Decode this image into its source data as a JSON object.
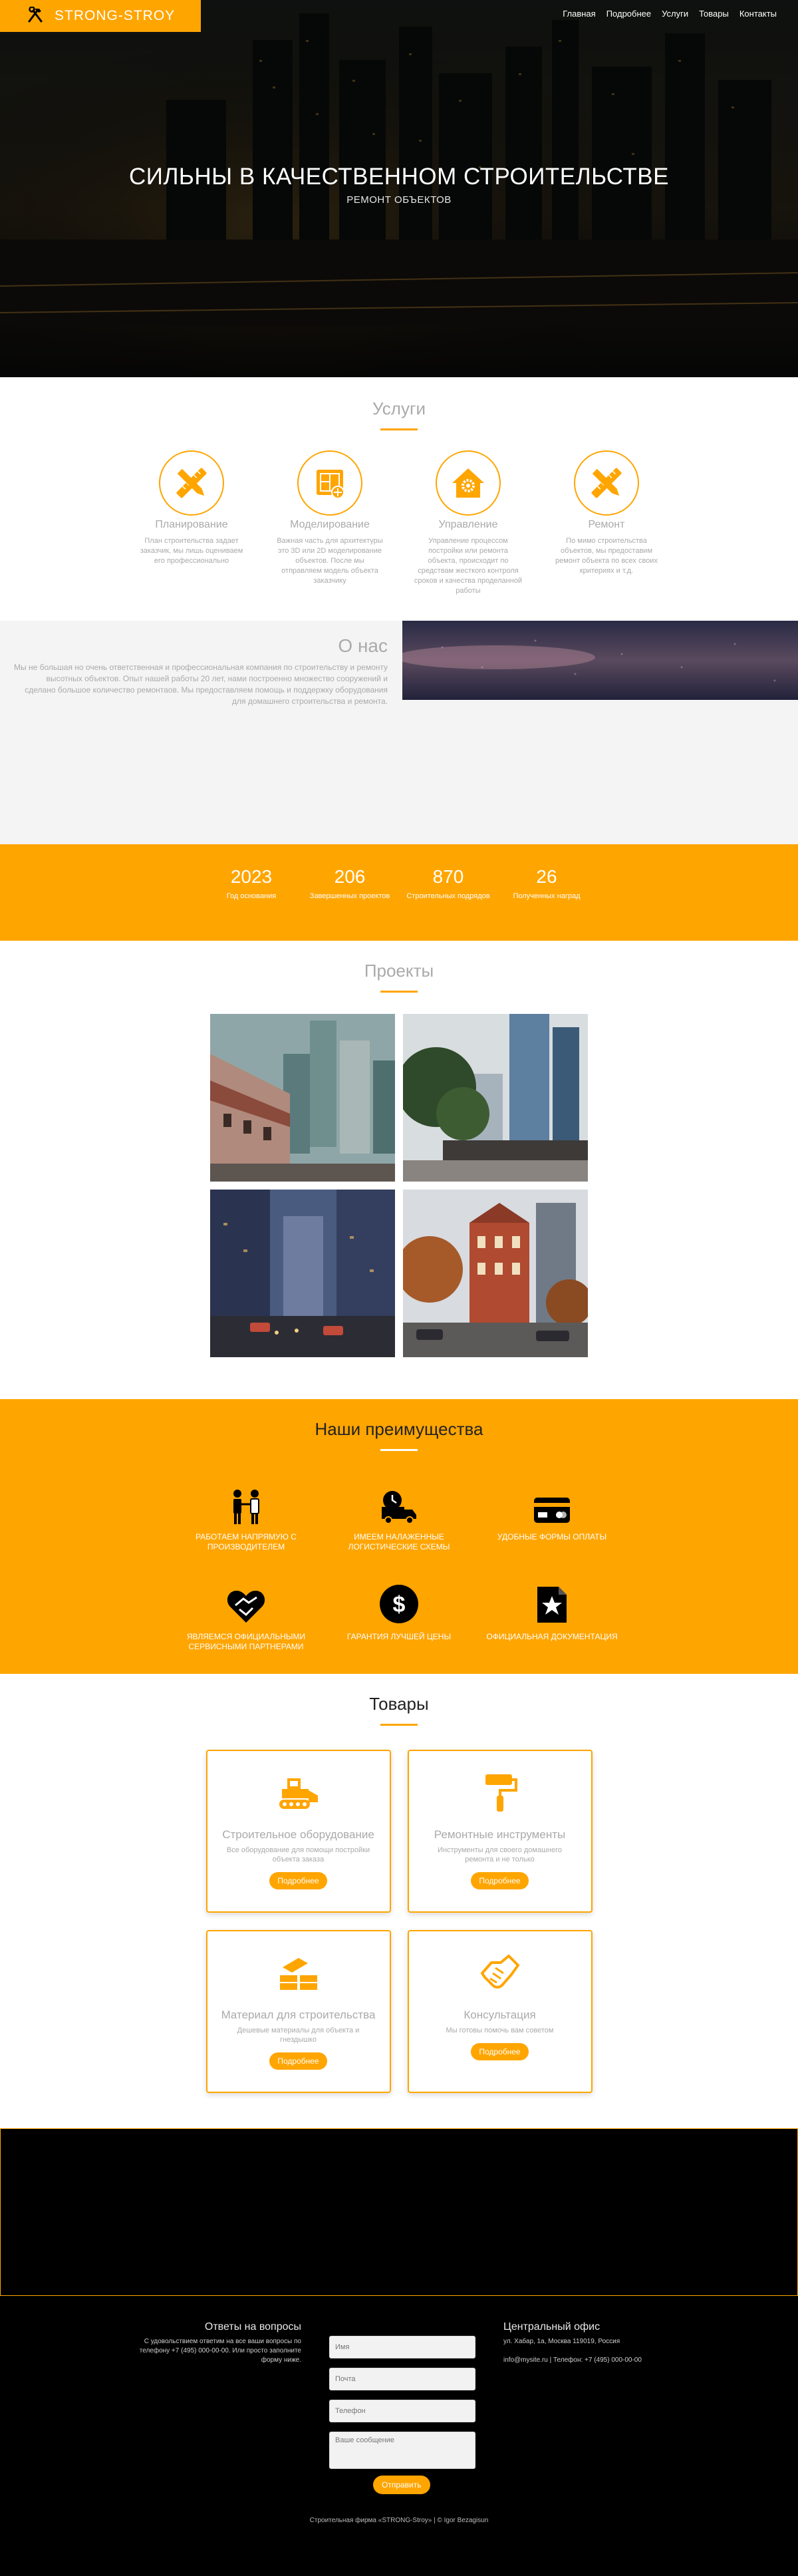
{
  "nav": {
    "brand": "STRONG-STROY",
    "links": [
      "Главная",
      "Подробнее",
      "Услуги",
      "Товары",
      "Контакты"
    ]
  },
  "hero": {
    "title": "СИЛЬНЫ В КАЧЕСТВЕННОМ СТРОИТЕЛЬСТВЕ",
    "subtitle": "РЕМОНТ ОБЪЕКТОВ"
  },
  "services": {
    "title": "Услуги",
    "items": [
      {
        "name": "Планирование",
        "desc": "План строительства задает заказчик, мы лишь оцениваем его профессионально",
        "icon": "pencil-ruler-icon"
      },
      {
        "name": "Моделирование",
        "desc": "Важная часть для архитектуры это 3D или 2D моделирование объектов. После мы отправляем модель объекта заказчику",
        "icon": "blueprint-icon"
      },
      {
        "name": "Управление",
        "desc": "Управление процессом постройки или ремонта объекта, происходит по средствам жесткого контроля сроков и качества проделанной работы",
        "icon": "house-gear-icon"
      },
      {
        "name": "Ремонт",
        "desc": "По мимо строительства объектов, мы предоставим ремонт объекта по всех своих критериях и т.д.",
        "icon": "pencil-ruler-icon"
      }
    ]
  },
  "about": {
    "title": "О нас",
    "text": "Мы не большая но очень ответственная и профессиональная компания по строительству и ремонту высотных объектов. Опыт нашей работы 20 лет, нами построенно множество сооружений и сделано большое количество ремонтаов. Мы предоставляем помощь и поддержку оборудования для домашнего строительства и ремонта."
  },
  "stats": [
    {
      "num": "2023",
      "label": "Год основания"
    },
    {
      "num": "206",
      "label": "Завершенных проектов"
    },
    {
      "num": "870",
      "label": "Строительных подрядов"
    },
    {
      "num": "26",
      "label": "Полученных наград"
    }
  ],
  "projects": {
    "title": "Проекты"
  },
  "advantages": {
    "title": "Наши преимущества",
    "items": [
      {
        "label": "РАБОТАЕМ НАПРЯМУЮ С ПРОИЗВОДИТЕЛЕМ",
        "icon": "handshake-people-icon"
      },
      {
        "label": "ИМЕЕМ НАЛАЖЕННЫЕ ЛОГИСТИЧЕСКИЕ СХЕМЫ",
        "icon": "delivery-truck-icon"
      },
      {
        "label": "УДОБНЫЕ ФОРМЫ ОПЛАТЫ",
        "icon": "credit-card-icon"
      },
      {
        "label": "ЯВЛЯЕМСЯ ОФИЦИАЛЬНЫМИ СЕРВИСНЫМИ ПАРТНЕРАМИ",
        "icon": "heart-handshake-icon"
      },
      {
        "label": "ГАРАНТИЯ ЛУЧШЕЙ ЦЕНЫ",
        "icon": "dollar-icon"
      },
      {
        "label": "ОФИЦИАЛЬНАЯ ДОКУМЕНТАЦИЯ",
        "icon": "document-star-icon"
      }
    ]
  },
  "goods": {
    "title": "Товары",
    "items": [
      {
        "title": "Строительное оборудование",
        "desc": "Все оборудование для помощи постройки объекта заказа",
        "button": "Подробнее",
        "icon": "bulldozer-icon"
      },
      {
        "title": "Ремонтные инструменты",
        "desc": "Инструменты для своего домашнего ремонта и не только",
        "button": "Подробнее",
        "icon": "paint-roller-icon"
      },
      {
        "title": "Материал для строительства",
        "desc": "Дешевые материалы для объекта и гнездышко",
        "button": "Подробнее",
        "icon": "bricks-icon"
      },
      {
        "title": "Консультация",
        "desc": "Мы готовы помочь вам советом",
        "button": "Подробнее",
        "icon": "handshake-icon"
      }
    ]
  },
  "footer": {
    "contact_title": "Ответы на вопросы",
    "contact_text": "С удовольствием ответим на все ваши вопросы по телефону +7 (495) 000-00-00. Или просто заполните форму ниже.",
    "form": {
      "name_placeholder": "Имя",
      "email_placeholder": "Почта",
      "phone_placeholder": "Телефон",
      "message_placeholder": "Ваше сообщение",
      "send_label": "Отправить"
    },
    "office_title": "Центральный офис",
    "address": "ул. Хабар, 1а, Москва 119019, Россия",
    "email_phone": "info@mysite.ru  |  Телефон: +7 (495) 000-00-00",
    "copyright": "Строительная фирма «STRONG-Stroy» | © Igor Bezagisun"
  },
  "colors": {
    "accent": "#ffa500",
    "dark": "#000000"
  }
}
